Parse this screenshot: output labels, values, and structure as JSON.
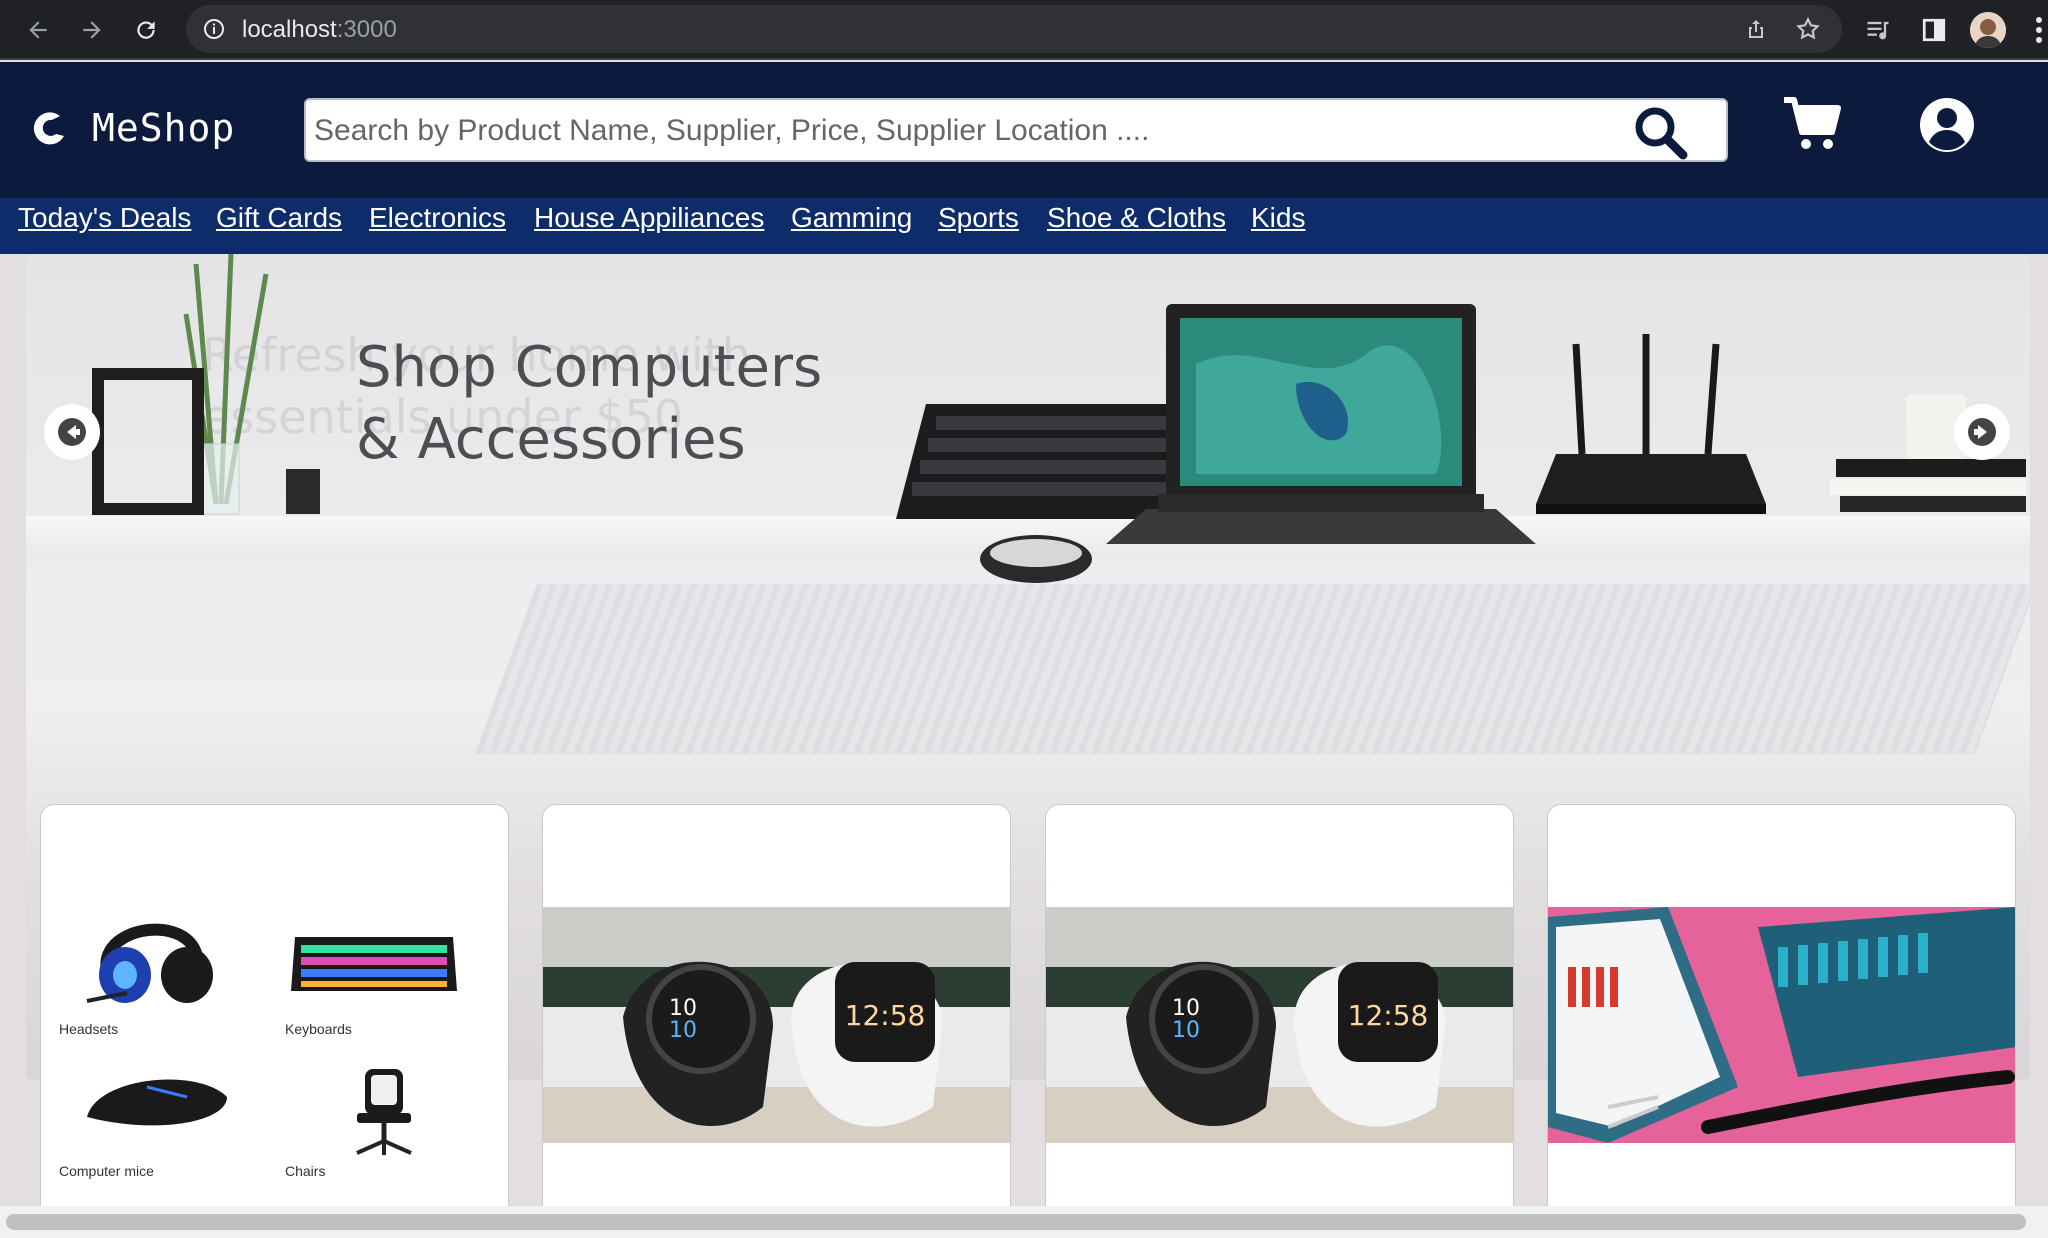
{
  "browser": {
    "url_host": "localhost",
    "url_port": ":3000"
  },
  "site": {
    "name": "MeShop",
    "search_placeholder": "Search by Product Name, Supplier, Price, Supplier Location ....",
    "colors": {
      "header": "#0c1a3e",
      "category_bar": "#0e2b6a",
      "accent": "#1d3a75"
    }
  },
  "categories": [
    "Today's Deals",
    "Gift Cards",
    "Electronics",
    "House Appiliances",
    "Gamming",
    "Sports",
    "Shoe & Cloths",
    "Kids"
  ],
  "hero": {
    "title_line1": "Shop Computers",
    "title_line2": "& Accessories",
    "ghost_line1": "Refresh your home with",
    "ghost_line2": "essentials under $50"
  },
  "cards": [
    {
      "type": "quad",
      "items": [
        "Headsets",
        "Keyboards",
        "Computer mice",
        "Chairs"
      ]
    },
    {
      "type": "image",
      "image": "smartwatches"
    },
    {
      "type": "image",
      "image": "smartwatches"
    },
    {
      "type": "image",
      "image": "tool-kit"
    }
  ],
  "watch_text": {
    "left_time": "10",
    "left_time2": "10",
    "right_time": "12:58"
  }
}
